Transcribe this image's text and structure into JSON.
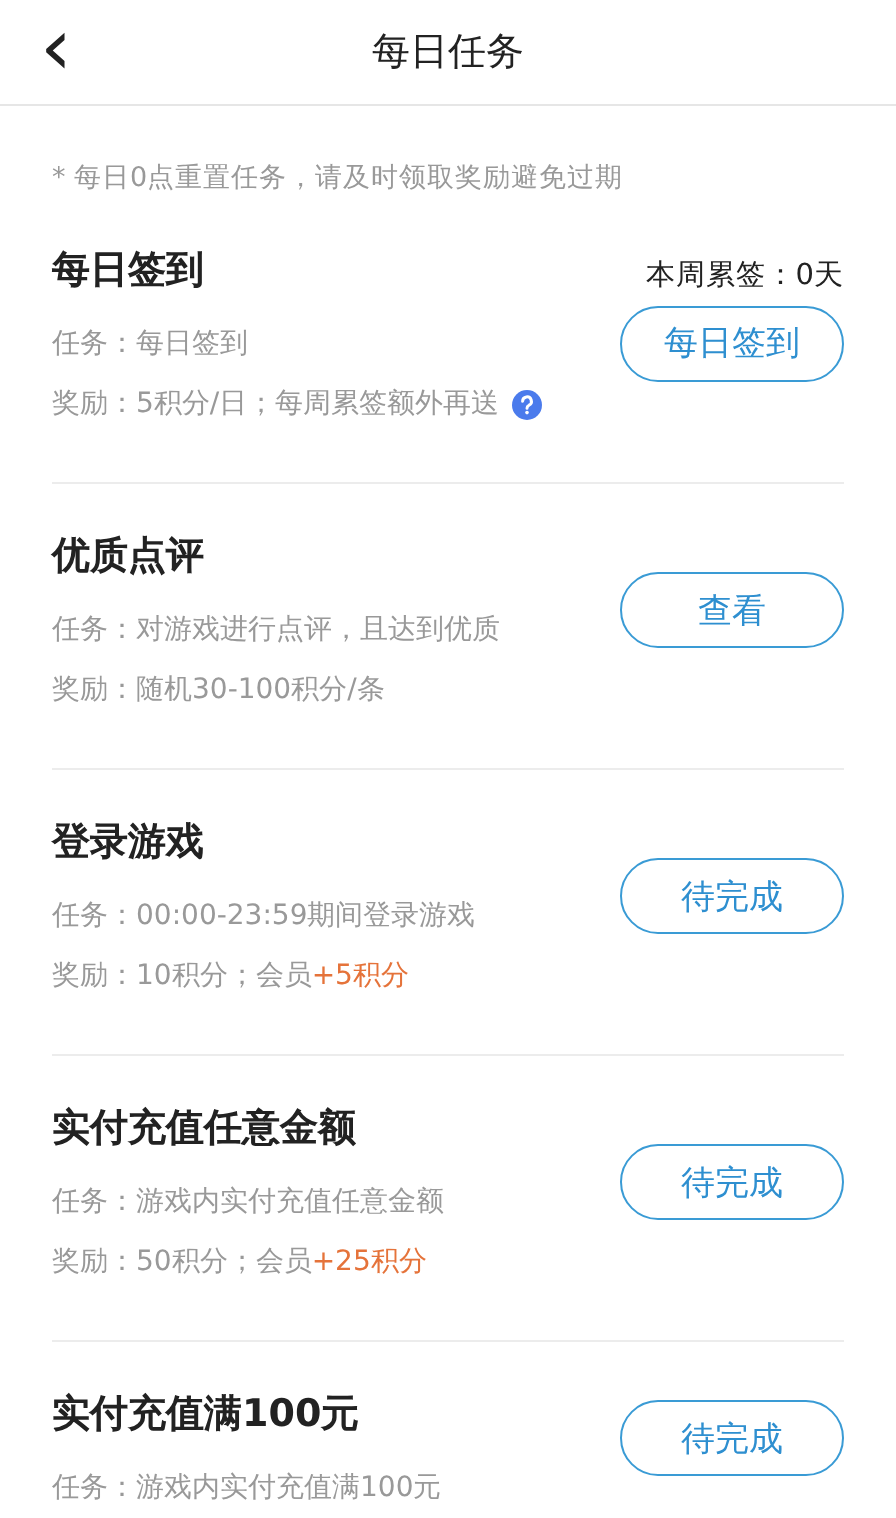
{
  "header": {
    "back": "‹",
    "title": "每日任务"
  },
  "note": "* 每日0点重置任务，请及时领取奖励避免过期",
  "tasks": [
    {
      "title": "每日签到",
      "week_count": "本周累签：0天",
      "task": "任务：每日签到",
      "reward": "奖励：5积分/日；每周累签额外再送",
      "help": true,
      "button": "每日签到"
    },
    {
      "title": "优质点评",
      "task": "任务：对游戏进行点评，且达到优质",
      "reward": "奖励：随机30-100积分/条",
      "button": "查看"
    },
    {
      "title": "登录游戏",
      "task": "任务：00:00-23:59期间登录游戏",
      "reward": "奖励：10积分；会员",
      "bonus": "+5积分",
      "button": "待完成"
    },
    {
      "title": "实付充值任意金额",
      "task": "任务：游戏内实付充值任意金额",
      "reward": "奖励：50积分；会员",
      "bonus": "+25积分",
      "button": "待完成"
    },
    {
      "title": "实付充值满100元",
      "task": "任务：游戏内实付充值满100元",
      "button": "待完成"
    }
  ]
}
